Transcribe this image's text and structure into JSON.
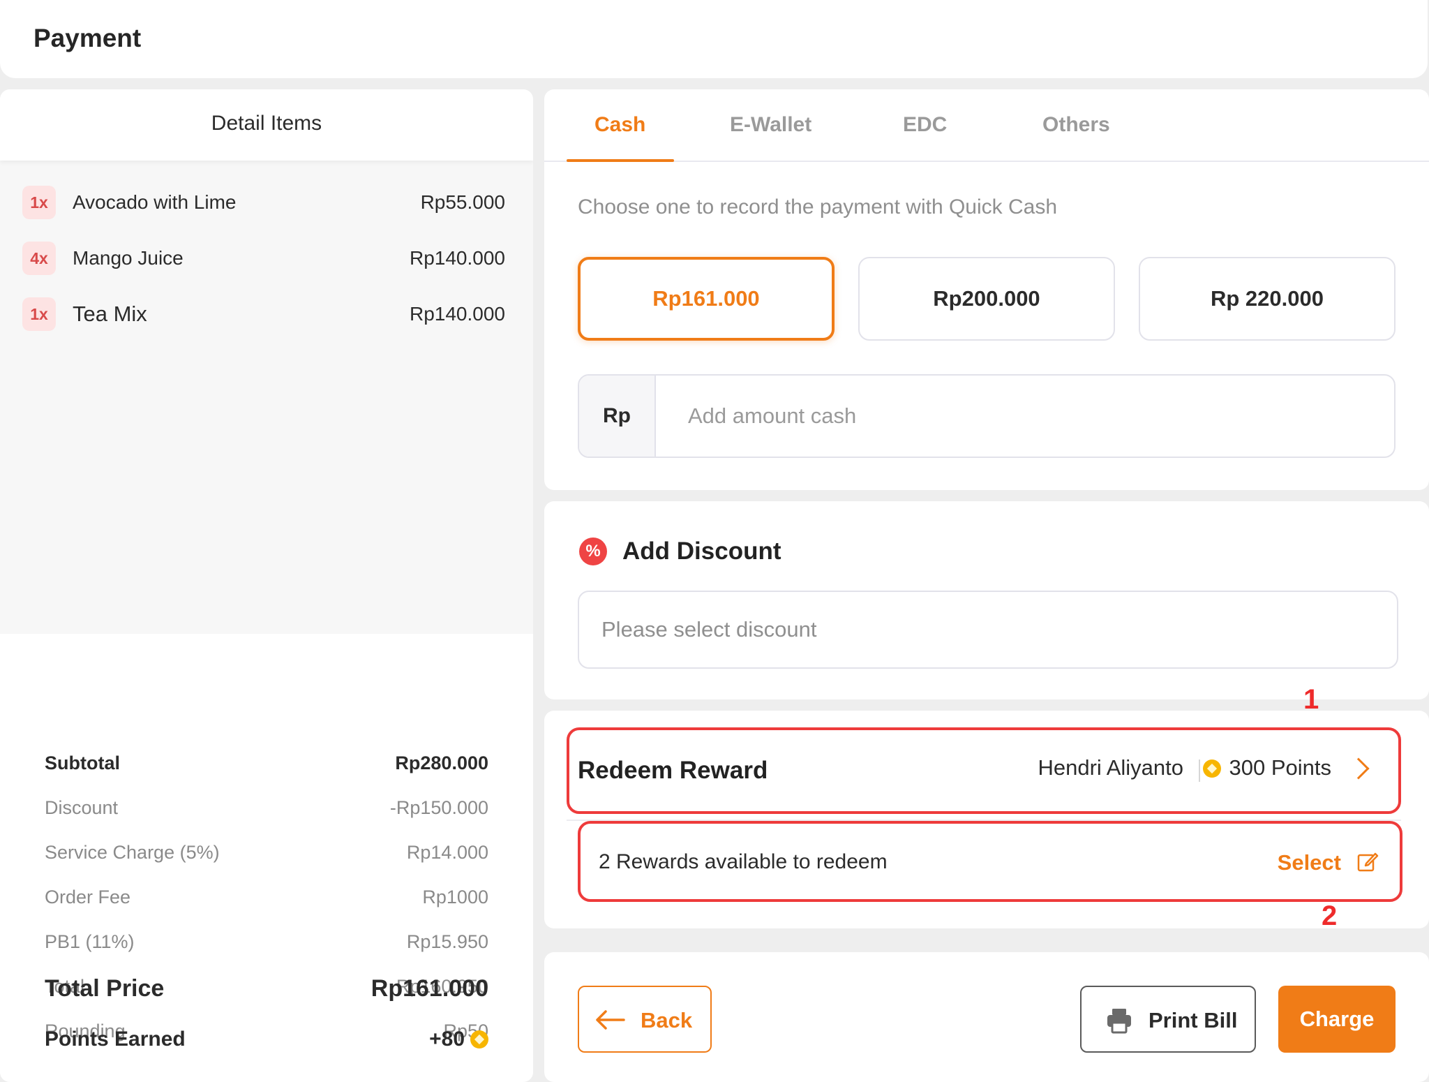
{
  "header": {
    "title": "Payment"
  },
  "detail": {
    "title": "Detail Items",
    "items": [
      {
        "qty": "1x",
        "name": "Avocado with Lime",
        "price": "Rp55.000"
      },
      {
        "qty": "4x",
        "name": "Mango Juice",
        "price": "Rp140.000"
      },
      {
        "qty": "1x",
        "name": "Tea Mix",
        "price": "Rp140.000"
      }
    ]
  },
  "summary": {
    "subtotal": {
      "label": "Subtotal",
      "value": "Rp280.000"
    },
    "discount": {
      "label": "Discount",
      "value": "-Rp150.000"
    },
    "service": {
      "label": "Service Charge (5%)",
      "value": "Rp14.000"
    },
    "order_fee": {
      "label": "Order Fee",
      "value": "Rp1000"
    },
    "pb1": {
      "label": "PB1 (11%)",
      "value": "Rp15.950"
    },
    "total": {
      "label": "Total",
      "value": "Rp160.950"
    },
    "rounding": {
      "label": "Rounding",
      "value": "Rp50"
    },
    "total_price": {
      "label": "Total Price",
      "value": "Rp161.000"
    },
    "points_earned": {
      "label": "Points Earned",
      "value": "+80"
    }
  },
  "payment": {
    "tabs": [
      "Cash",
      "E-Wallet",
      "EDC",
      "Others"
    ],
    "active_tab": "Cash",
    "hint": "Choose one to record the payment with Quick Cash",
    "quick_cash": [
      "Rp161.000",
      "Rp200.000",
      "Rp 220.000"
    ],
    "selected_quick_cash": "Rp161.000",
    "amount_prefix": "Rp",
    "amount_placeholder": "Add amount cash",
    "amount_value": ""
  },
  "discount": {
    "title": "Add Discount",
    "placeholder": "Please select discount"
  },
  "reward": {
    "title": "Redeem Reward",
    "customer": "Hendri Aliyanto",
    "points": "300 Points",
    "available": "2 Rewards available to redeem",
    "select_label": "Select",
    "annotation_1": "1",
    "annotation_2": "2"
  },
  "actions": {
    "back": "Back",
    "print": "Print Bill",
    "charge": "Charge"
  },
  "colors": {
    "accent": "#f07c17",
    "highlight": "#ee3b3b",
    "coin": "#f7b500"
  }
}
